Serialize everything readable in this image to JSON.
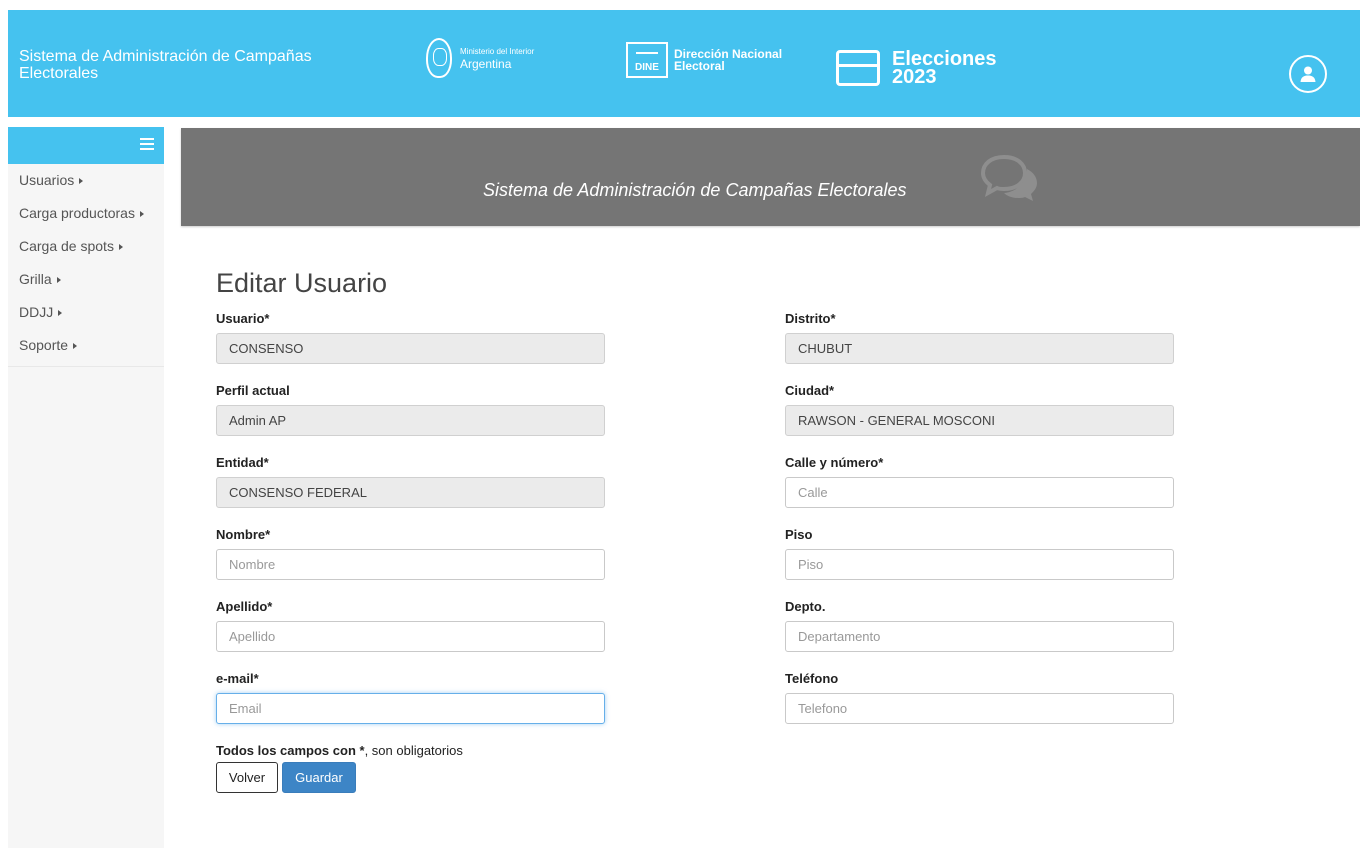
{
  "header": {
    "app_title": "Sistema de Administración de Campañas Electorales",
    "ministry_small": "Ministerio del Interior",
    "ministry_main": "Argentina",
    "dine_badge": "DINE",
    "dine_line1": "Dirección Nacional",
    "dine_line2": "Electoral",
    "elections_line1": "Elecciones",
    "elections_line2": "2023",
    "user_icon": "user-icon"
  },
  "sidebar": {
    "items": [
      {
        "label": "Usuarios"
      },
      {
        "label": "Carga productoras"
      },
      {
        "label": "Carga de spots"
      },
      {
        "label": "Grilla"
      },
      {
        "label": "DDJJ"
      },
      {
        "label": "Soporte"
      }
    ]
  },
  "banner": {
    "title": "Sistema de Administración de Campañas Electorales"
  },
  "form": {
    "title": "Editar Usuario",
    "usuario": {
      "label": "Usuario*",
      "value": "CONSENSO"
    },
    "perfil": {
      "label": "Perfil actual",
      "value": "Admin AP"
    },
    "entidad": {
      "label": "Entidad*",
      "value": "CONSENSO FEDERAL"
    },
    "nombre": {
      "label": "Nombre*",
      "value": "",
      "placeholder": "Nombre"
    },
    "apellido": {
      "label": "Apellido*",
      "value": "",
      "placeholder": "Apellido"
    },
    "email": {
      "label": "e-mail*",
      "value": "",
      "placeholder": "Email"
    },
    "distrito": {
      "label": "Distrito*",
      "value": "CHUBUT"
    },
    "ciudad": {
      "label": "Ciudad*",
      "value": "RAWSON - GENERAL MOSCONI"
    },
    "calle": {
      "label": "Calle y número*",
      "value": "",
      "placeholder": "Calle"
    },
    "piso": {
      "label": "Piso",
      "value": "",
      "placeholder": "Piso"
    },
    "depto": {
      "label": "Depto.",
      "value": "",
      "placeholder": "Departamento"
    },
    "telefono": {
      "label": "Teléfono",
      "value": "",
      "placeholder": "Telefono"
    },
    "note_bold": "Todos los campos con *",
    "note_rest": ", son obligatorios",
    "back_label": "Volver",
    "save_label": "Guardar"
  },
  "colors": {
    "header_bg": "#45c2ef",
    "banner_bg": "#757575",
    "primary_button": "#3d85c6"
  }
}
